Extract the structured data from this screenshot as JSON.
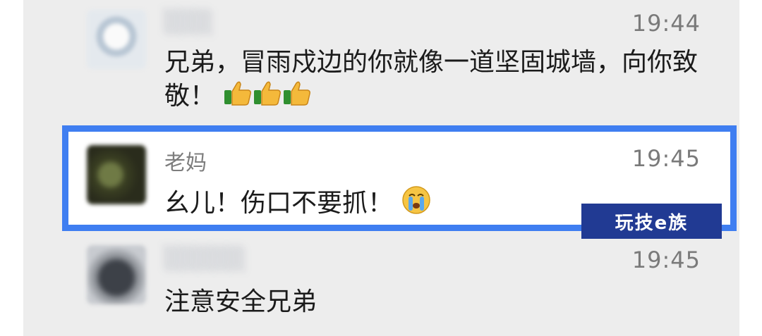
{
  "messages": [
    {
      "sender": "",
      "time": "19:44",
      "text": "兄弟，冒雨戍边的你就像一道坚固城墙，向你致敬！",
      "emoji": [
        "thumbs-up-icon",
        "thumbs-up-icon",
        "thumbs-up-icon"
      ]
    },
    {
      "sender": "老妈",
      "time": "19:45",
      "text": "幺儿！伤口不要抓！",
      "emoji": [
        "crying-face-icon"
      ]
    },
    {
      "sender": "",
      "time": "19:45",
      "text": "注意安全兄弟"
    }
  ],
  "watermark": {
    "label": "玩技e族"
  },
  "colors": {
    "highlight_border": "#3f7ef1",
    "watermark_bg": "#213a93",
    "panel_bg": "#ededed"
  }
}
